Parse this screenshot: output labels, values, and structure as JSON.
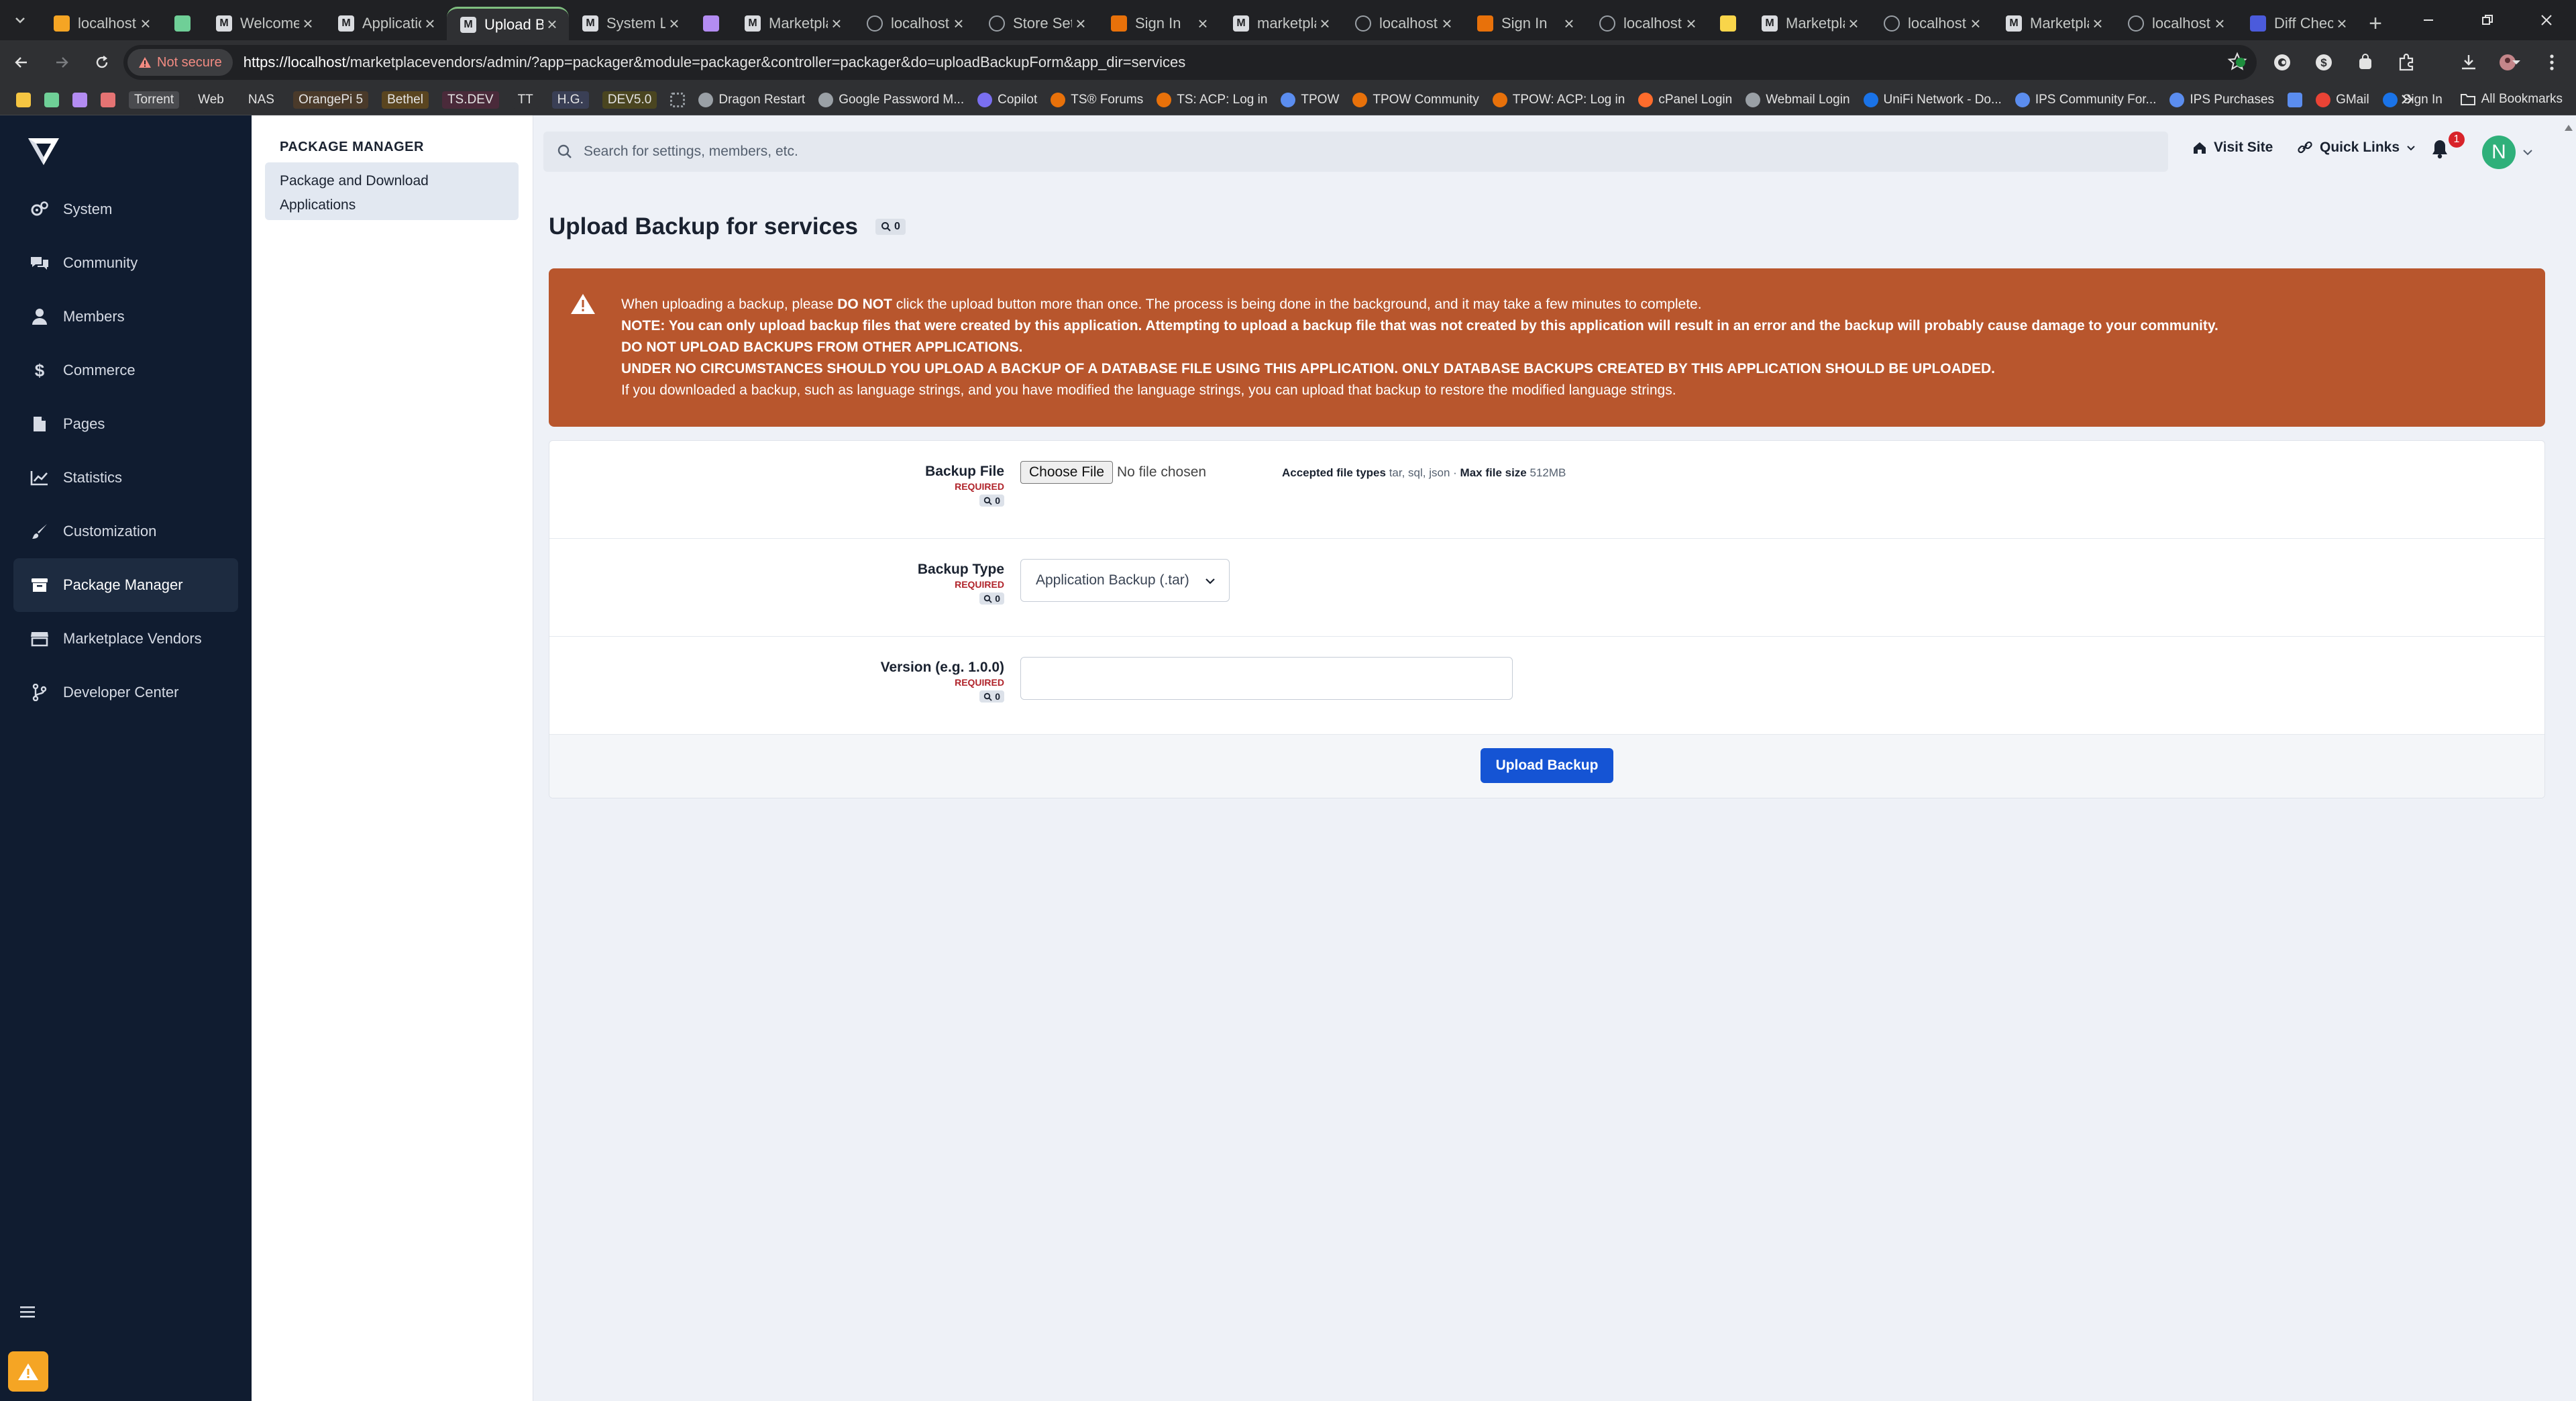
{
  "browser": {
    "tabs": [
      {
        "title": "localhost",
        "favicon": "ips-icon",
        "color": "#f5a524",
        "active": false
      },
      {
        "title": "",
        "favicon": "green-square-icon",
        "color": "#6fcf97",
        "active": false,
        "fav_only": true
      },
      {
        "title": "Welcome",
        "favicon": "m-icon",
        "color": "#bdbdbd",
        "active": false
      },
      {
        "title": "Applicatio",
        "favicon": "m-icon",
        "color": "#bdbdbd",
        "active": false
      },
      {
        "title": "Upload B",
        "favicon": "m-icon",
        "color": "#bdbdbd",
        "active": true
      },
      {
        "title": "System L",
        "favicon": "m-icon",
        "color": "#bdbdbd",
        "active": false
      },
      {
        "title": "",
        "favicon": "purple-square-icon",
        "color": "#b38cf2",
        "active": false,
        "fav_only": true
      },
      {
        "title": "Marketpla",
        "favicon": "m-icon",
        "color": "#bdbdbd",
        "active": false
      },
      {
        "title": "localhost",
        "favicon": "globe-icon",
        "color": "#9aa0a6",
        "active": false
      },
      {
        "title": "Store Setti",
        "favicon": "globe-icon",
        "color": "#9aa0a6",
        "active": false
      },
      {
        "title": "Sign In",
        "favicon": "ips-icon",
        "color": "#e8710a",
        "active": false
      },
      {
        "title": "marketpla",
        "favicon": "m-icon",
        "color": "#bdbdbd",
        "active": false
      },
      {
        "title": "localhost",
        "favicon": "globe-icon",
        "color": "#9aa0a6",
        "active": false
      },
      {
        "title": "Sign In",
        "favicon": "ips-icon",
        "color": "#e8710a",
        "active": false
      },
      {
        "title": "localhost",
        "favicon": "globe-icon",
        "color": "#9aa0a6",
        "active": false
      },
      {
        "title": "",
        "favicon": "yellow-square-icon",
        "color": "#f9d54a",
        "active": false,
        "fav_only": true
      },
      {
        "title": "Marketpla",
        "favicon": "m-icon",
        "color": "#bdbdbd",
        "active": false
      },
      {
        "title": "localhost",
        "favicon": "globe-icon",
        "color": "#9aa0a6",
        "active": false
      },
      {
        "title": "Marketpla",
        "favicon": "m-icon",
        "color": "#bdbdbd",
        "active": false
      },
      {
        "title": "localhost",
        "favicon": "globe-icon",
        "color": "#9aa0a6",
        "active": false
      },
      {
        "title": "Diff Chec",
        "favicon": "diff-icon",
        "color": "#4b5bdc",
        "active": false
      }
    ],
    "address": {
      "security_label": "Not secure",
      "url_host": "https://localhost",
      "url_path": "/marketplacevendors/admin/?app=packager&module=packager&controller=packager&do=uploadBackupForm&app_dir=services"
    },
    "bookmarks": [
      {
        "label": "",
        "kind": "icon",
        "color": "#f5c542"
      },
      {
        "label": "",
        "kind": "icon",
        "color": "#6fcf97"
      },
      {
        "label": "",
        "kind": "icon",
        "color": "#b38cf2"
      },
      {
        "label": "",
        "kind": "icon",
        "color": "#e57373"
      },
      {
        "label": "Torrent",
        "kind": "tag",
        "color": "#4a4b4f"
      },
      {
        "label": "Web",
        "kind": "tag",
        "color": "#2f3033"
      },
      {
        "label": "NAS",
        "kind": "tag",
        "color": "#2f3033"
      },
      {
        "label": "OrangePi 5",
        "kind": "tag",
        "color": "#4a3a2a"
      },
      {
        "label": "Bethel",
        "kind": "tag",
        "color": "#5a4520"
      },
      {
        "label": "TS.DEV",
        "kind": "tag",
        "color": "#4a2a3a"
      },
      {
        "label": "TT",
        "kind": "tag",
        "color": "#2f3033"
      },
      {
        "label": "H.G.",
        "kind": "tag",
        "color": "#3a3f55"
      },
      {
        "label": "DEV5.0",
        "kind": "tag",
        "color": "#4a4520"
      },
      {
        "label": "",
        "kind": "apps",
        "color": "#9aa0a6"
      },
      {
        "label": "Dragon Restart",
        "kind": "link",
        "color": "#9aa0a6"
      },
      {
        "label": "Google Password M...",
        "kind": "link",
        "color": "#9aa0a6"
      },
      {
        "label": "Copilot",
        "kind": "link",
        "color": "#7a6ff0"
      },
      {
        "label": "TS® Forums",
        "kind": "link",
        "color": "#e8710a"
      },
      {
        "label": "TS: ACP: Log in",
        "kind": "link",
        "color": "#e8710a"
      },
      {
        "label": "TPOW",
        "kind": "link",
        "color": "#5b8def"
      },
      {
        "label": "TPOW Community",
        "kind": "link",
        "color": "#e8710a"
      },
      {
        "label": "TPOW: ACP: Log in",
        "kind": "link",
        "color": "#e8710a"
      },
      {
        "label": "cPanel Login",
        "kind": "link",
        "color": "#ff6c2c"
      },
      {
        "label": "Webmail Login",
        "kind": "link",
        "color": "#9aa0a6"
      },
      {
        "label": "UniFi Network - Do...",
        "kind": "link",
        "color": "#1a73e8"
      },
      {
        "label": "IPS Community For...",
        "kind": "link",
        "color": "#5b8def"
      },
      {
        "label": "IPS Purchases",
        "kind": "link",
        "color": "#5b8def"
      },
      {
        "label": "",
        "kind": "icon",
        "color": "#5b8def"
      },
      {
        "label": "GMail",
        "kind": "link",
        "color": "#ea4335"
      },
      {
        "label": "Sign In",
        "kind": "link",
        "color": "#1a73e8"
      }
    ],
    "all_bookmarks_label": "All Bookmarks"
  },
  "sidebar": {
    "items": [
      {
        "label": "System",
        "icon": "gears-icon"
      },
      {
        "label": "Community",
        "icon": "chat-bubbles-icon"
      },
      {
        "label": "Members",
        "icon": "user-icon"
      },
      {
        "label": "Commerce",
        "icon": "dollar-icon"
      },
      {
        "label": "Pages",
        "icon": "page-icon"
      },
      {
        "label": "Statistics",
        "icon": "chart-line-icon"
      },
      {
        "label": "Customization",
        "icon": "paintbrush-icon"
      },
      {
        "label": "Package Manager",
        "icon": "archive-box-icon",
        "active": true
      },
      {
        "label": "Marketplace Vendors",
        "icon": "store-icon"
      },
      {
        "label": "Developer Center",
        "icon": "code-branch-icon"
      }
    ]
  },
  "submenu": {
    "title": "PACKAGE MANAGER",
    "item_line1": "Package and Download",
    "item_line2": "Applications"
  },
  "header": {
    "search_placeholder": "Search for settings, members, etc.",
    "visit_site": "Visit Site",
    "quick_links": "Quick Links",
    "notification_count": "1",
    "avatar_initial": "N"
  },
  "page": {
    "title": "Upload Backup for services",
    "title_badge": "0"
  },
  "warning": {
    "line1_pre": "When uploading a backup, please ",
    "line1_bold": "DO NOT",
    "line1_post": " click the upload button more than once. The process is being done in the background, and it may take a few minutes to complete.",
    "line2": "NOTE: You can only upload backup files that were created by this application. Attempting to upload a backup file that was not created by this application will result in an error and the backup will probably cause damage to your community.",
    "line3": "DO NOT UPLOAD BACKUPS FROM OTHER APPLICATIONS.",
    "line4": "UNDER NO CIRCUMSTANCES SHOULD YOU UPLOAD A BACKUP OF A DATABASE FILE USING THIS APPLICATION. ONLY DATABASE BACKUPS CREATED BY THIS APPLICATION SHOULD BE UPLOADED.",
    "line5": "If you downloaded a backup, such as language strings, and you have modified the language strings, you can upload that backup to restore the modified language strings."
  },
  "form": {
    "backup_file": {
      "label": "Backup File",
      "required": "REQUIRED",
      "badge": "0",
      "button": "Choose File",
      "status": "No file chosen",
      "accepted_label": "Accepted file types",
      "accepted_value": "tar, sql, json",
      "separator": "·",
      "max_label": "Max file size",
      "max_value": "512MB"
    },
    "backup_type": {
      "label": "Backup Type",
      "required": "REQUIRED",
      "badge": "0",
      "selected": "Application Backup (.tar)"
    },
    "version": {
      "label": "Version (e.g. 1.0.0)",
      "required": "REQUIRED",
      "badge": "0",
      "value": "",
      "placeholder": ""
    },
    "submit": "Upload Backup"
  }
}
